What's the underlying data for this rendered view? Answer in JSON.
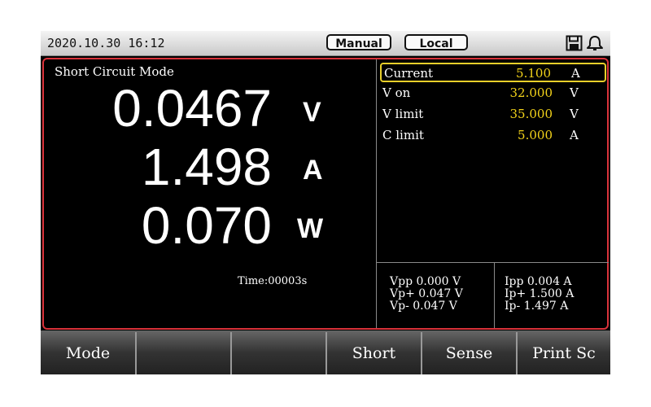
{
  "status_bar": {
    "datetime": "2020.10.30 16:12",
    "mode_label": "Manual",
    "control_label": "Local",
    "icons": [
      "save-icon",
      "bell-icon"
    ]
  },
  "main": {
    "mode_title": "Short Circuit Mode",
    "voltage": {
      "value": "0.0467",
      "unit": "V"
    },
    "current": {
      "value": "1.498",
      "unit": "A"
    },
    "power": {
      "value": "0.070",
      "unit": "W"
    },
    "timer": "Time:00003s"
  },
  "params": [
    {
      "name": "Current",
      "value": "5.100",
      "unit": "A",
      "selected": true
    },
    {
      "name": "V on",
      "value": "32.000",
      "unit": "V",
      "selected": false
    },
    {
      "name": "V limit",
      "value": "35.000",
      "unit": "V",
      "selected": false
    },
    {
      "name": "C limit",
      "value": "5.000",
      "unit": "A",
      "selected": false
    }
  ],
  "peaks": {
    "voltage": [
      "Vpp 0.000 V",
      "Vp+ 0.047 V",
      "Vp- 0.047 V"
    ],
    "current": [
      "Ipp 0.004 A",
      "Ip+ 1.500 A",
      "Ip- 1.497 A"
    ]
  },
  "softkeys": [
    "Mode",
    "",
    "",
    "Short",
    "Sense",
    "Print Sc"
  ],
  "colors": {
    "accent_border": "#d8323a",
    "value_text": "#f2d21a",
    "selection": "#e8cf2a"
  }
}
